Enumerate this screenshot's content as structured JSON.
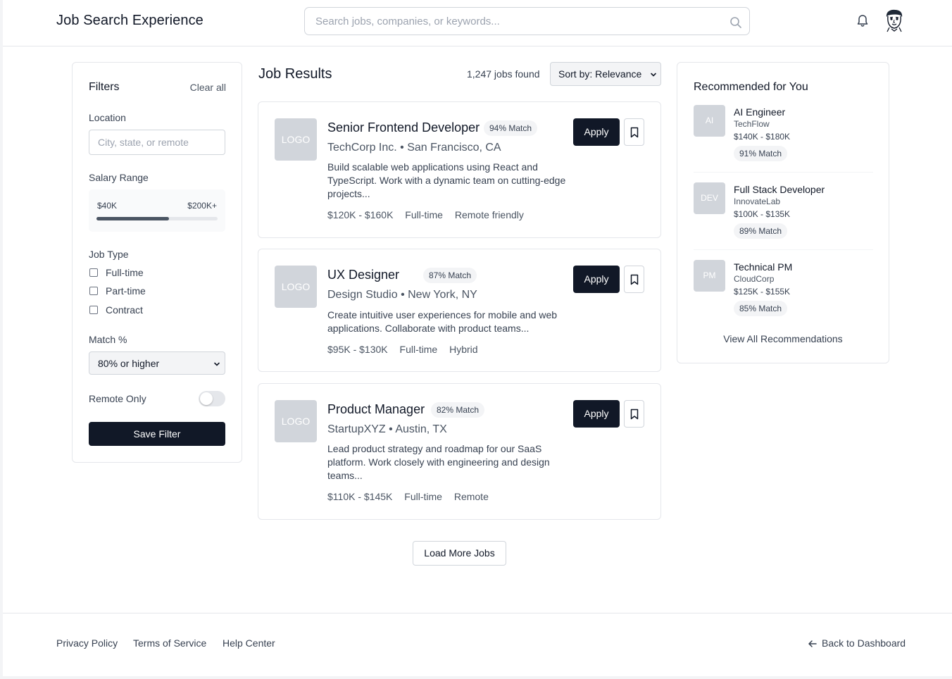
{
  "header": {
    "title": "Job Search Experience",
    "search_placeholder": "Search jobs, companies, or keywords...",
    "icons": [
      "search-icon",
      "bell-icon",
      "avatar"
    ]
  },
  "filters": {
    "title": "Filters",
    "clear_all": "Clear all",
    "location_label": "Location",
    "location_placeholder": "City, state, or remote",
    "salary_label": "Salary Range",
    "salary_min": "$40K",
    "salary_max": "$200K+",
    "salary_fill_fraction": 0.6,
    "job_type_label": "Job Type",
    "job_types": [
      "Full-time",
      "Part-time",
      "Contract"
    ],
    "match_label": "Match %",
    "match_value": "80% or higher",
    "remote_label": "Remote Only",
    "remote_on": false,
    "save_label": "Save Filter"
  },
  "results": {
    "title": "Job Results",
    "count": "1,247 jobs found",
    "sort": "Sort by: Relevance",
    "apply_label": "Apply",
    "load_more": "Load More Jobs",
    "jobs": [
      {
        "logo": "LOGO",
        "title": "Senior Frontend Developer",
        "match": "94% Match",
        "company": "TechCorp Inc. • San Francisco, CA",
        "description": "Build scalable web applications using React and TypeScript. Work with a dynamic team on cutting-edge projects...",
        "salary": "$120K - $160K",
        "type": "Full-time",
        "mode": "Remote friendly"
      },
      {
        "logo": "LOGO",
        "title": "UX Designer",
        "match": "87% Match",
        "company": "Design Studio • New York, NY",
        "description": "Create intuitive user experiences for mobile and web applications. Collaborate with product teams...",
        "salary": "$95K - $130K",
        "type": "Full-time",
        "mode": "Hybrid"
      },
      {
        "logo": "LOGO",
        "title": "Product Manager",
        "match": "82% Match",
        "company": "StartupXYZ • Austin, TX",
        "description": "Lead product strategy and roadmap for our SaaS platform. Work closely with engineering and design teams...",
        "salary": "$110K - $145K",
        "type": "Full-time",
        "mode": "Remote"
      }
    ]
  },
  "recommendations": {
    "title": "Recommended for You",
    "items": [
      {
        "initials": "AI",
        "title": "AI Engineer",
        "company": "TechFlow",
        "salary": "$140K - $180K",
        "match": "91% Match"
      },
      {
        "initials": "DEV",
        "title": "Full Stack Developer",
        "company": "InnovateLab",
        "salary": "$100K - $135K",
        "match": "89% Match"
      },
      {
        "initials": "PM",
        "title": "Technical PM",
        "company": "CloudCorp",
        "salary": "$125K - $155K",
        "match": "85% Match"
      }
    ],
    "view_all": "View All Recommendations"
  },
  "footer": {
    "links": [
      "Privacy Policy",
      "Terms of Service",
      "Help Center"
    ],
    "back": "Back to Dashboard"
  }
}
